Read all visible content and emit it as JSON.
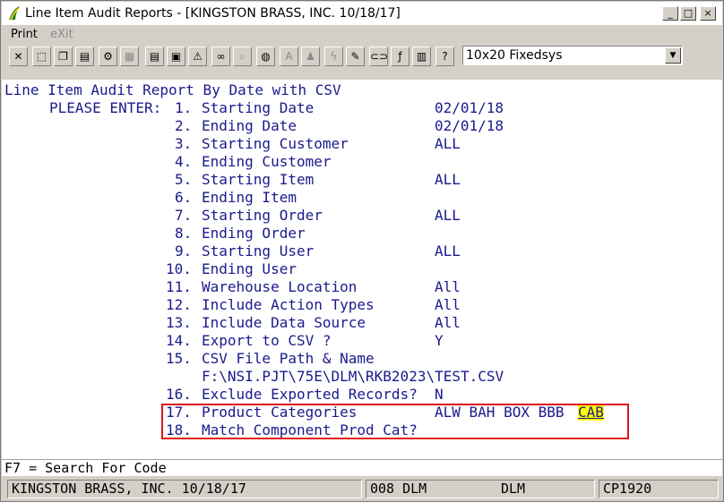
{
  "window": {
    "title": "Line Item Audit Reports - [KINGSTON BRASS, INC. 10/18/17]"
  },
  "title_buttons": {
    "min": "_",
    "max": "□",
    "close": "×"
  },
  "menu": [
    {
      "label": "Print",
      "enabled": true
    },
    {
      "label": "eXit",
      "enabled": false
    }
  ],
  "toolbar": {
    "icons": [
      "cut-icon",
      "select-icon",
      "copy-icon",
      "paste-icon",
      "settings-icon",
      "properties-icon",
      "notes-icon",
      "printer-icon",
      "alert-icon",
      "binoculars-icon",
      "search-icon",
      "globe-icon",
      "font-icon",
      "stamp-icon",
      "lightning-icon",
      "edit-icon",
      "link-icon",
      "function-icon",
      "calculator-icon",
      "help-pointer-icon"
    ],
    "font_select": "10x20 Fixedsys"
  },
  "report": {
    "heading": "Line Item Audit Report By Date with CSV",
    "prompt": "PLEASE ENTER:",
    "items": [
      {
        "num": "1.",
        "label": "Starting Date",
        "value": "02/01/18"
      },
      {
        "num": "2.",
        "label": "Ending Date",
        "value": "02/01/18"
      },
      {
        "num": "3.",
        "label": "Starting Customer",
        "value": "ALL"
      },
      {
        "num": "4.",
        "label": "Ending Customer",
        "value": ""
      },
      {
        "num": "5.",
        "label": "Starting Item",
        "value": "ALL"
      },
      {
        "num": "6.",
        "label": "Ending Item",
        "value": ""
      },
      {
        "num": "7.",
        "label": "Starting Order",
        "value": "ALL"
      },
      {
        "num": "8.",
        "label": "Ending Order",
        "value": ""
      },
      {
        "num": "9.",
        "label": "Starting User",
        "value": "ALL"
      },
      {
        "num": "10.",
        "label": "Ending User",
        "value": ""
      },
      {
        "num": "11.",
        "label": "Warehouse Location",
        "value": "All"
      },
      {
        "num": "12.",
        "label": "Include Action Types",
        "value": "All"
      },
      {
        "num": "13.",
        "label": "Include Data Source",
        "value": "All"
      },
      {
        "num": "14.",
        "label": "Export to CSV ?",
        "value": "Y"
      }
    ],
    "item15": {
      "num": "15.",
      "label": "CSV File Path & Name",
      "path": "F:\\NSI.PJT\\75E\\DLM\\RKB2023\\TEST.CSV"
    },
    "item16": {
      "num": "16.",
      "label": "Exclude Exported Records?",
      "value": "N"
    },
    "item17": {
      "num": "17.",
      "label": "Product Categories",
      "value": "ALW BAH BOX BBB",
      "current": "CAB"
    },
    "item18": {
      "num": "18.",
      "label": "Match Component Prod Cat?",
      "value": ""
    }
  },
  "function_line": "F7 = Search For Code",
  "status": {
    "company": "KINGSTON BRASS, INC. 10/18/17",
    "user_code": "008 DLM",
    "user": "DLM",
    "port": "CP1920"
  }
}
